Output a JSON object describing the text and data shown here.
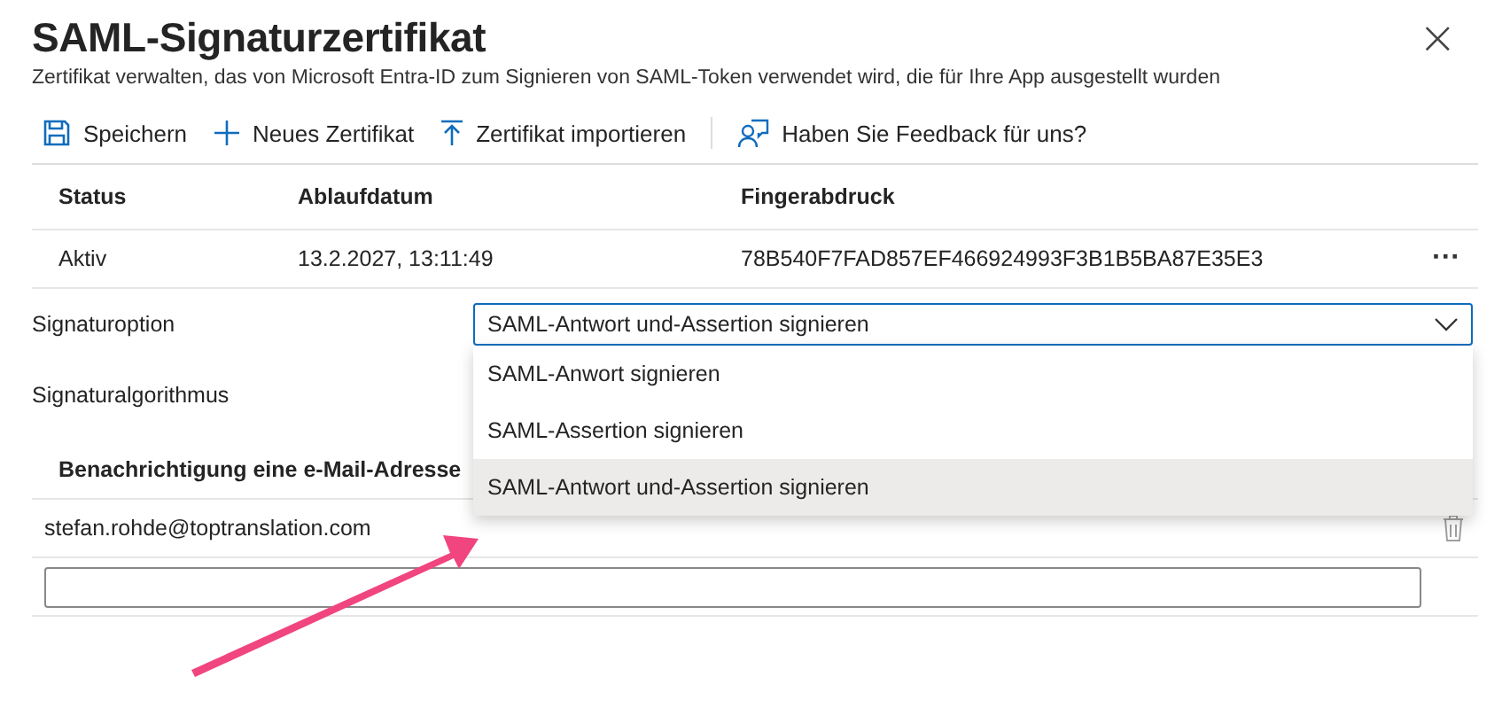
{
  "panel": {
    "title": "SAML-Signaturzertifikat",
    "subtitle": "Zertifikat verwalten, das von Microsoft Entra-ID zum Signieren von SAML-Token verwendet wird, die für Ihre App ausgestellt wurden",
    "close": "×"
  },
  "toolbar": [
    {
      "kind": "save",
      "label": "Speichern"
    },
    {
      "kind": "new",
      "label": "Neues Zertifikat"
    },
    {
      "kind": "import",
      "label": "Zertifikat importieren"
    },
    {
      "kind": "feedback",
      "label": "Haben Sie Feedback für uns?"
    }
  ],
  "table": {
    "columns": [
      "Status",
      "Ablaufdatum",
      "Fingerabdruck"
    ],
    "rows": [
      {
        "cells": [
          "Aktiv",
          "13.2.2027, 13:11:49",
          "78B540F7FAD857EF466924993F3B1B5BA87E35E3"
        ],
        "more": "···"
      }
    ]
  },
  "signature_option": {
    "label": "Signaturoption",
    "value": "SAML-Antwort und-Assertion signieren",
    "expanded": true,
    "options": [
      {
        "label": "SAML-Anwort signieren",
        "selected": false
      },
      {
        "label": "SAML-Assertion signieren",
        "selected": false
      },
      {
        "label": "SAML-Antwort und-Assertion signieren",
        "selected": true
      }
    ]
  },
  "signature_algorithm": {
    "label": "Signaturalgorithmus"
  },
  "notification": {
    "heading": "Benachrichtigung eine e-Mail-Adresse",
    "emails": [
      "stefan.rohde@toptranslation.com"
    ]
  },
  "annotation": {
    "kind": "arrow"
  }
}
